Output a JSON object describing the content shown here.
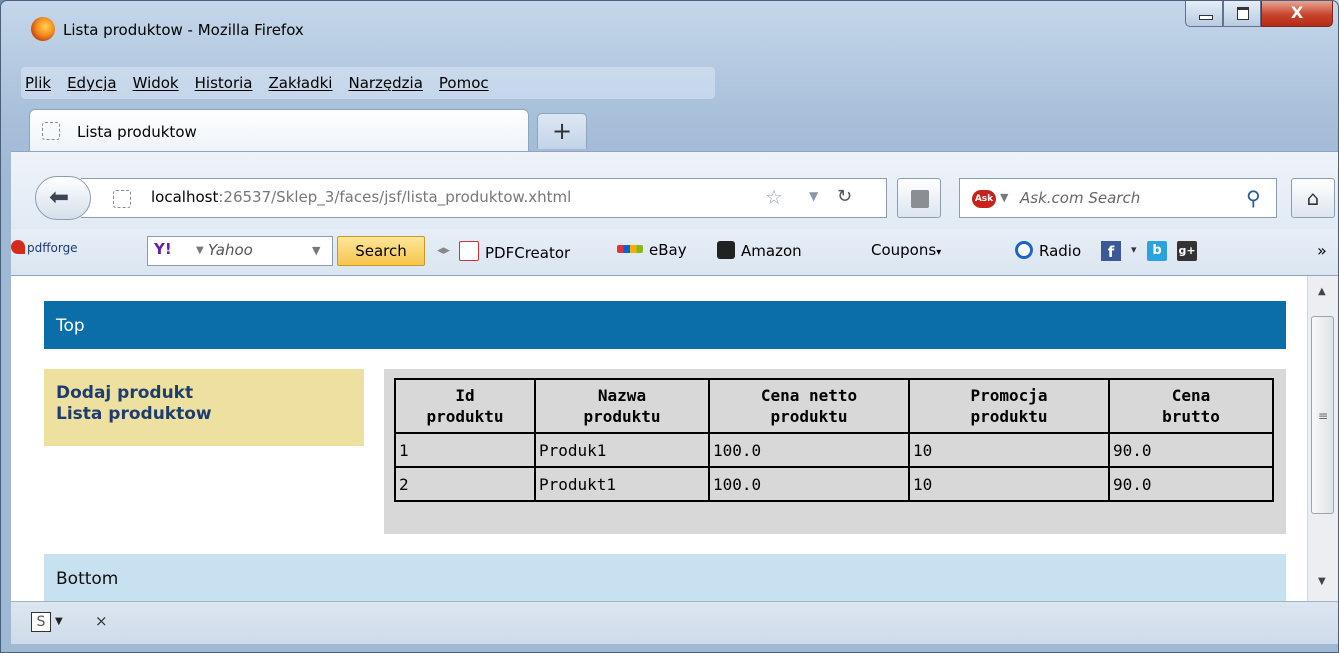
{
  "window": {
    "title": "Lista produktow - Mozilla Firefox",
    "close_glyph": "X"
  },
  "menu": [
    "Plik",
    "Edycja",
    "Widok",
    "Historia",
    "Zakładki",
    "Narzędzia",
    "Pomoc"
  ],
  "tab": {
    "label": "Lista produktow",
    "new_tab_glyph": "+"
  },
  "nav": {
    "url_host": "localhost",
    "url_path": ":26537/Sklep_3/faces/jsf/lista_produktow.xhtml",
    "search_placeholder": "Ask.com Search",
    "search_engine_badge": "Ask"
  },
  "bookmarks": {
    "pdfforge": "pdfforge",
    "yahoo_logo": "Y!",
    "yahoo_placeholder": "Yahoo",
    "search_button": "Search",
    "pdfcreator": "PDFCreator",
    "ebay": "eBay",
    "amazon": "Amazon",
    "coupons": "Coupons",
    "radio": "Radio",
    "facebook": "f",
    "b": "b",
    "gplus": "g+",
    "more": "»"
  },
  "page": {
    "top": "Top",
    "bottom": "Bottom",
    "links": [
      "Dodaj produkt",
      "Lista produktow"
    ],
    "table": {
      "headers": [
        [
          "Id",
          "produktu"
        ],
        [
          "Nazwa",
          "produktu"
        ],
        [
          "Cena netto",
          "produktu"
        ],
        [
          "Promocja",
          "produktu"
        ],
        [
          "Cena",
          "brutto"
        ]
      ],
      "rows": [
        [
          "1",
          "Produk1",
          "100.0",
          "10",
          "90.0"
        ],
        [
          "2",
          "Produkt1",
          "100.0",
          "10",
          "90.0"
        ]
      ]
    }
  },
  "statusbar": {
    "icon": "S",
    "close": "×"
  }
}
